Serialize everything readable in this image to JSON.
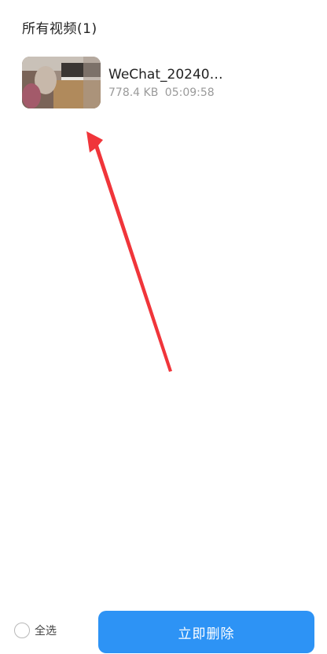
{
  "header": {
    "title": "所有视频(1)"
  },
  "videos": [
    {
      "name": "WeChat_20240…",
      "size": "778.4 KB",
      "time": "05:09:58",
      "thumbnail_icon": "video-thumbnail"
    }
  ],
  "annotation": {
    "arrow_color": "#f0353a"
  },
  "footer": {
    "select_all_label": "全选",
    "delete_label": "立即删除",
    "delete_color": "#2d93f5"
  }
}
